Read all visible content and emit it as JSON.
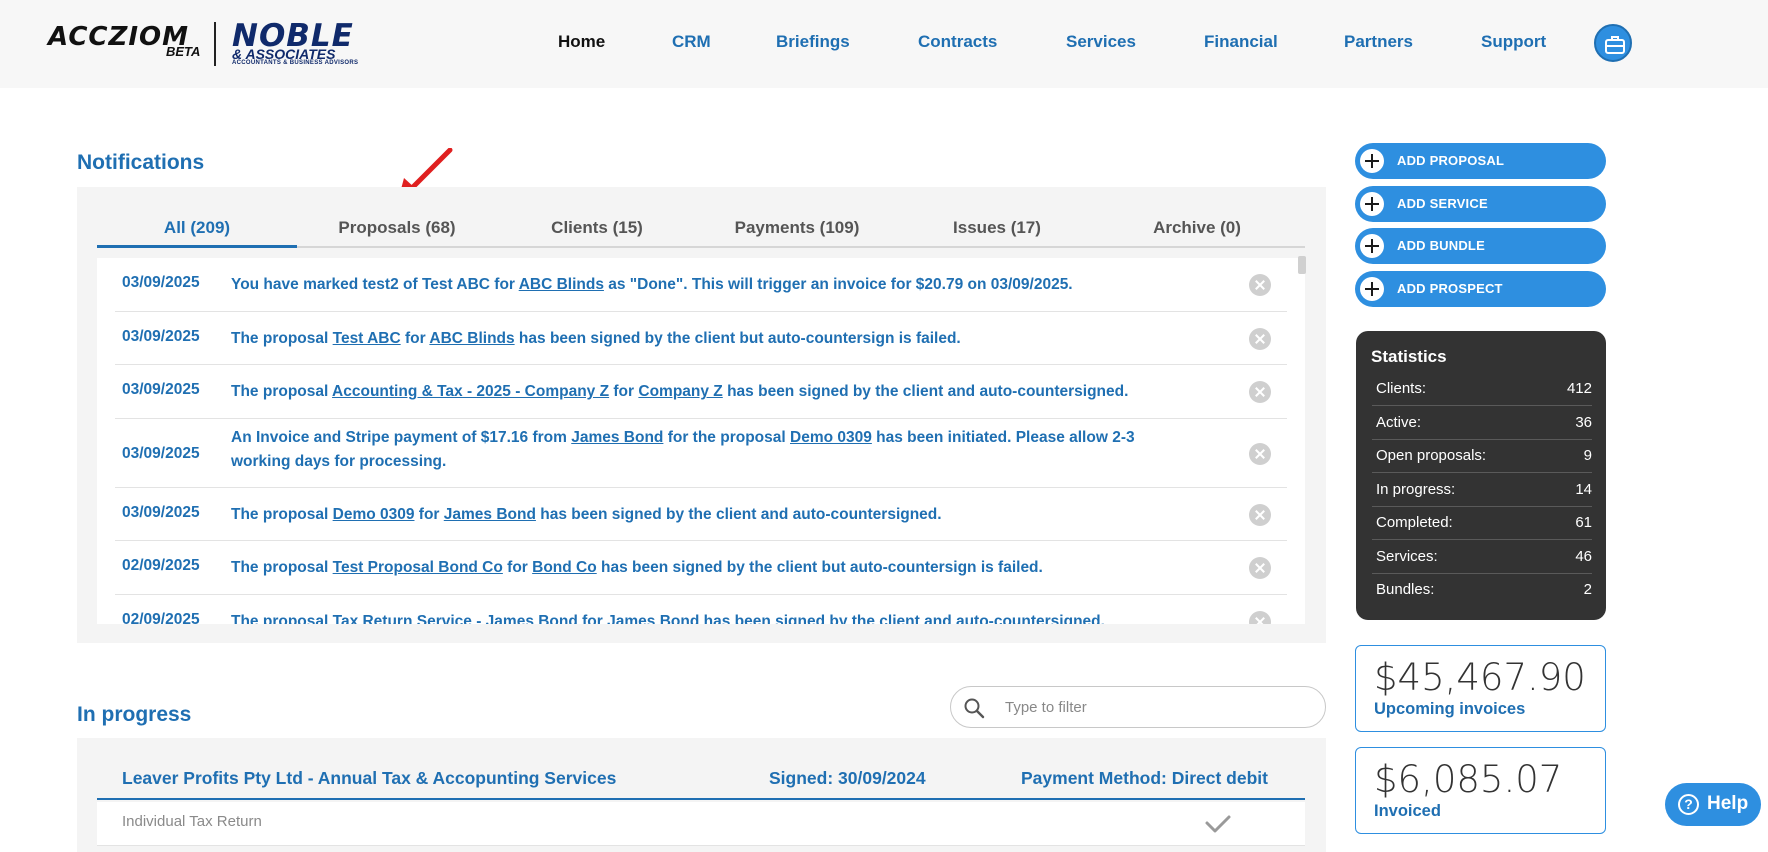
{
  "brand": {
    "name": "ACCZIOM",
    "beta": "BETA",
    "partner": "NOBLE",
    "partner_sub": "& ASSOCIATES",
    "partner_tag": "ACCOUNTANTS & BUSINESS ADVISORS"
  },
  "nav": {
    "items": [
      "Home",
      "CRM",
      "Briefings",
      "Contracts",
      "Services",
      "Financial",
      "Partners",
      "Support"
    ],
    "active": "Home",
    "icon": "briefcase-icon"
  },
  "notifications": {
    "title": "Notifications",
    "tabs": [
      "All (209)",
      "Proposals (68)",
      "Clients (15)",
      "Payments (109)",
      "Issues (17)",
      "Archive (0)"
    ],
    "active_tab": "All (209)",
    "rows": [
      {
        "date": "03/09/2025",
        "parts": [
          {
            "t": "You have marked test2 of Test ABC for "
          },
          {
            "t": "ABC Blinds",
            "link": true
          },
          {
            "t": " as \"Done\". This will trigger an invoice for $20.79 on 03/09/2025."
          }
        ]
      },
      {
        "date": "03/09/2025",
        "parts": [
          {
            "t": "The proposal "
          },
          {
            "t": "Test ABC",
            "link": true
          },
          {
            "t": " for "
          },
          {
            "t": "ABC Blinds",
            "link": true
          },
          {
            "t": " has been signed by the client but auto-countersign is failed."
          }
        ]
      },
      {
        "date": "03/09/2025",
        "parts": [
          {
            "t": "The proposal "
          },
          {
            "t": "Accounting & Tax - 2025 - Company Z",
            "link": true
          },
          {
            "t": " for "
          },
          {
            "t": "Company Z",
            "link": true
          },
          {
            "t": " has been signed by the client and auto-countersigned."
          }
        ]
      },
      {
        "date": "03/09/2025",
        "parts": [
          {
            "t": "An Invoice and Stripe payment of $17.16 from "
          },
          {
            "t": "James Bond",
            "link": true
          },
          {
            "t": " for the proposal "
          },
          {
            "t": "Demo 0309",
            "link": true
          },
          {
            "t": " has been initiated. Please allow 2-3 working days for processing."
          }
        ]
      },
      {
        "date": "03/09/2025",
        "parts": [
          {
            "t": "The proposal "
          },
          {
            "t": "Demo 0309",
            "link": true
          },
          {
            "t": " for "
          },
          {
            "t": "James Bond",
            "link": true
          },
          {
            "t": " has been signed by the client and auto-countersigned."
          }
        ]
      },
      {
        "date": "02/09/2025",
        "parts": [
          {
            "t": "The proposal "
          },
          {
            "t": "Test Proposal Bond Co",
            "link": true
          },
          {
            "t": " for "
          },
          {
            "t": "Bond Co",
            "link": true
          },
          {
            "t": " has been signed by the client but auto-countersign is failed."
          }
        ]
      },
      {
        "date": "02/09/2025",
        "parts": [
          {
            "t": "The proposal "
          },
          {
            "t": "Tax Return Service - James Bond",
            "link": true
          },
          {
            "t": " for "
          },
          {
            "t": "James Bond",
            "link": true
          },
          {
            "t": " has been signed by the client and auto-countersigned."
          }
        ]
      }
    ]
  },
  "in_progress": {
    "title": "In progress",
    "filter_placeholder": "Type to filter",
    "header": {
      "name": "Leaver Profits Pty Ltd - Annual Tax & Accopunting Services",
      "signed": "Signed: 30/09/2024",
      "payment": "Payment Method: Direct debit"
    },
    "items": [
      "Individual Tax Return"
    ]
  },
  "actions": [
    "ADD PROPOSAL",
    "ADD SERVICE",
    "ADD BUNDLE",
    "ADD PROSPECT"
  ],
  "statistics": {
    "title": "Statistics",
    "rows": [
      {
        "k": "Clients:",
        "v": "412"
      },
      {
        "k": "Active:",
        "v": "36"
      },
      {
        "k": "Open proposals:",
        "v": "9"
      },
      {
        "k": "In progress:",
        "v": "14"
      },
      {
        "k": "Completed:",
        "v": "61"
      },
      {
        "k": "Services:",
        "v": "46"
      },
      {
        "k": "Bundles:",
        "v": "2"
      }
    ]
  },
  "money": [
    {
      "amount": "$45,467.90",
      "label": "Upcoming invoices"
    },
    {
      "amount": "$6,085.07",
      "label": "Invoiced"
    }
  ],
  "help": {
    "label": "Help"
  },
  "colors": {
    "accent": "#2e8fe0",
    "link": "#1f6fb2",
    "stats_bg": "#333333",
    "annotation": "#e02020"
  }
}
